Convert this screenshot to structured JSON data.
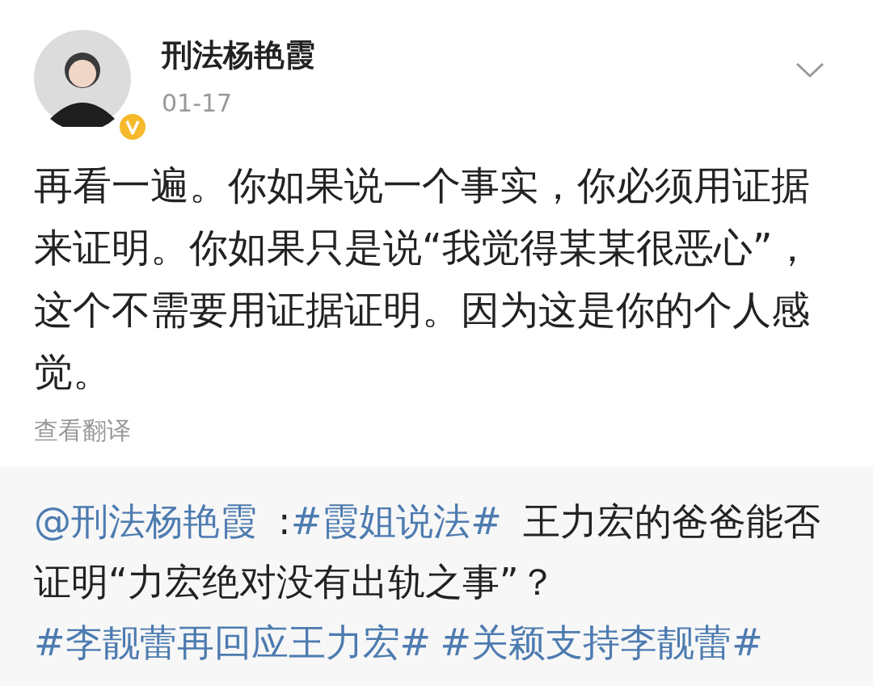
{
  "post": {
    "author": "刑法杨艳霞",
    "verified": true,
    "date": "01-17",
    "text": "再看一遍。你如果说一个事实，你必须用证据来证明。你如果只是说“我觉得某某很恶心”，这个不需要用证据证明。因为这是你的个人感觉。",
    "translate": "查看翻译"
  },
  "repost": {
    "segments": [
      {
        "kind": "link",
        "text": "@刑法杨艳霞"
      },
      {
        "kind": "text",
        "text": " :"
      },
      {
        "kind": "link",
        "text": "#霞姐说法#"
      },
      {
        "kind": "text",
        "text": " 王力宏的爸爸能否证明“力宏绝对没有出轨之事”？"
      },
      {
        "kind": "link",
        "text": "#李靓蕾再回应王力宏#"
      },
      {
        "kind": "link",
        "text": "#关颖支持李靓蕾#"
      }
    ]
  }
}
